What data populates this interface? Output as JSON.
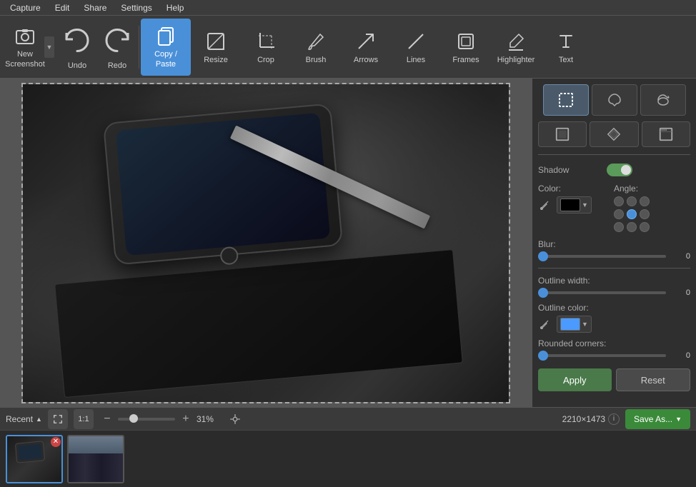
{
  "menu": {
    "items": [
      "Capture",
      "Edit",
      "Share",
      "Settings",
      "Help"
    ]
  },
  "toolbar": {
    "new_screenshot_label": "New Screenshot",
    "undo_label": "Undo",
    "redo_label": "Redo",
    "copy_paste_label": "Copy / Paste",
    "resize_label": "Resize",
    "crop_label": "Crop",
    "brush_label": "Brush",
    "arrows_label": "Arrows",
    "lines_label": "Lines",
    "frames_label": "Frames",
    "highlighter_label": "Highlighter",
    "text_label": "Text"
  },
  "right_panel": {
    "shadow_label": "Shadow",
    "color_label": "Color:",
    "angle_label": "Angle:",
    "blur_label": "Blur:",
    "blur_value": "0",
    "outline_width_label": "Outline width:",
    "outline_width_value": "0",
    "outline_color_label": "Outline color:",
    "rounded_corners_label": "Rounded corners:",
    "rounded_corners_value": "0",
    "apply_label": "Apply",
    "reset_label": "Reset"
  },
  "status_bar": {
    "recent_label": "Recent",
    "ratio_label": "1:1",
    "zoom_percent": "31%",
    "dimensions": "2210×1473",
    "save_label": "Save As..."
  },
  "thumbnails": [
    {
      "id": 1,
      "type": "notebook",
      "active": true
    },
    {
      "id": 2,
      "type": "city",
      "active": false
    }
  ]
}
